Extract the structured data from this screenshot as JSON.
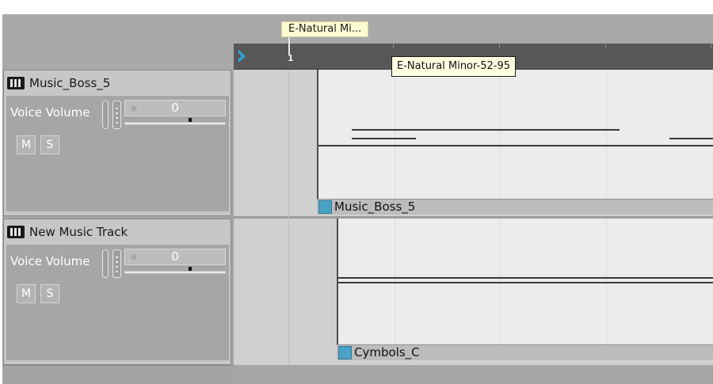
{
  "timeline": {
    "marker_label": "E-Natural Mi...",
    "tooltip": "E-Natural Minor-52-95",
    "bar_number": "1"
  },
  "tracks": [
    {
      "name": "Music_Boss_5",
      "volume_label": "Voice Volume",
      "volume_value": "0",
      "mute_label": "M",
      "solo_label": "S",
      "clip_name": "Music_Boss_5"
    },
    {
      "name": "New Music Track",
      "volume_label": "Voice Volume",
      "volume_value": "0",
      "mute_label": "M",
      "solo_label": "S",
      "clip_name": "Cymbols_C"
    }
  ],
  "icons": {
    "track": "track-icon",
    "playhead": "play-marker-icon",
    "volume_knob": "volume-knob-icon"
  },
  "colors": {
    "clip_swatch": "#4aa3c4",
    "playhead": "#2aa5e0",
    "tooltip_bg": "#ffffe1",
    "marker_bg": "#fefbd2"
  }
}
